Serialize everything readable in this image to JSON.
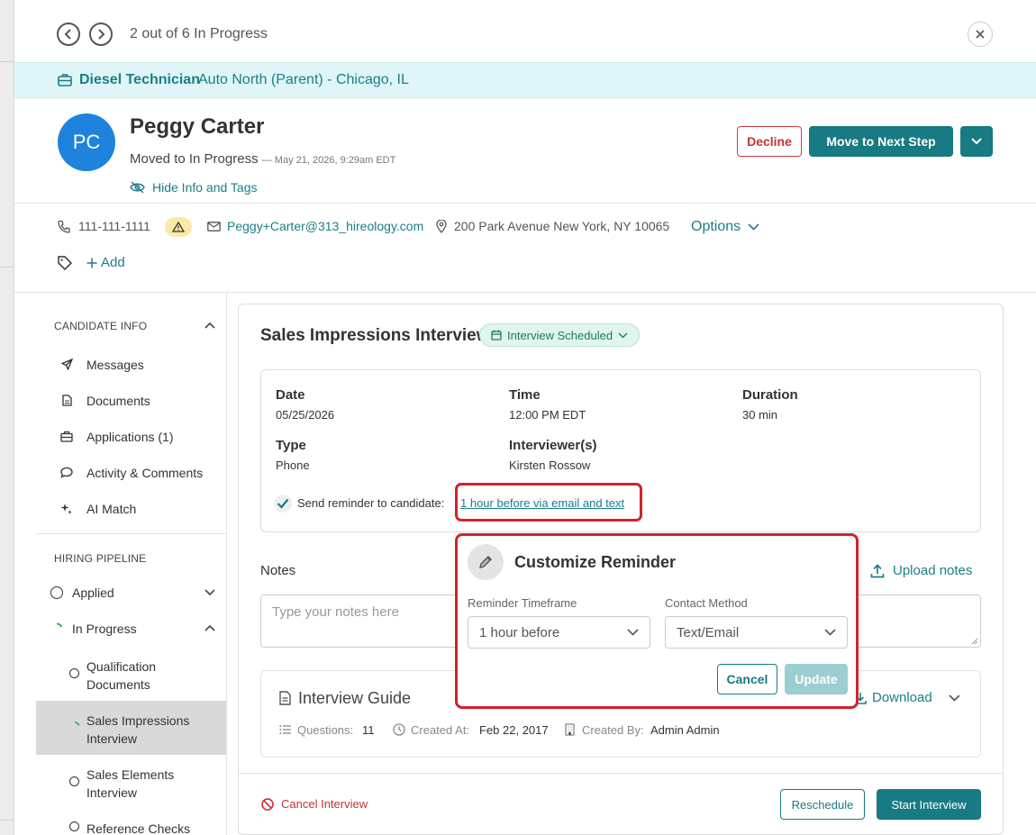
{
  "nav": {
    "counter": "2 out of 6 In Progress"
  },
  "job": {
    "title": "Diesel Technician",
    "location": "Auto North (Parent) - Chicago, IL"
  },
  "candidate": {
    "initials": "PC",
    "name": "Peggy Carter",
    "status": "Moved to In Progress",
    "status_time": "— May 21, 2026, 9:29am EDT",
    "hide_info": "Hide Info and Tags",
    "phone": "111-111-1111",
    "email": "Peggy+Carter@313_hireology.com",
    "address": "200 Park Avenue New York, NY 10065",
    "options": "Options",
    "add_tag": "Add"
  },
  "actions": {
    "decline": "Decline",
    "next_step": "Move to Next Step"
  },
  "sidebar": {
    "candidate_info_header": "CANDIDATE INFO",
    "candidate_items": [
      {
        "label": "Messages",
        "icon": "send-icon"
      },
      {
        "label": "Documents",
        "icon": "document-icon"
      },
      {
        "label": "Applications (1)",
        "icon": "briefcase-icon"
      },
      {
        "label": "Activity & Comments",
        "icon": "comment-icon"
      },
      {
        "label": "AI Match",
        "icon": "sparkle-icon"
      }
    ],
    "pipeline_header": "HIRING PIPELINE",
    "pipeline_items": [
      {
        "label": "Applied"
      },
      {
        "label": "In Progress"
      }
    ],
    "sub_items": [
      {
        "line1": "Qualification",
        "line2": "Documents"
      },
      {
        "line1": "Sales Impressions",
        "line2": "Interview"
      },
      {
        "line1": "Sales Elements",
        "line2": "Interview"
      },
      {
        "line1": "Reference Checks",
        "line2": ""
      }
    ]
  },
  "interview": {
    "title": "Sales Impressions Interview",
    "status_badge": "Interview Scheduled",
    "date_label": "Date",
    "date": "05/25/2026",
    "time_label": "Time",
    "time": "12:00 PM EDT",
    "duration_label": "Duration",
    "duration": "30 min",
    "type_label": "Type",
    "type": "Phone",
    "interviewer_label": "Interviewer(s)",
    "interviewer": "Kirsten Rossow",
    "reminder_label": "Send reminder to candidate:",
    "reminder_link": "1 hour before via email and text"
  },
  "notes": {
    "label": "Notes",
    "upload": "Upload notes",
    "placeholder": "Type your notes here"
  },
  "guide": {
    "title": "Interview Guide",
    "download": "Download",
    "questions_label": "Questions:",
    "questions": "11",
    "created_at_label": "Created At:",
    "created_at": "Feb 22, 2017",
    "created_by_label": "Created By:",
    "created_by": "Admin Admin"
  },
  "footer": {
    "cancel_interview": "Cancel Interview",
    "reschedule": "Reschedule",
    "start": "Start Interview"
  },
  "popover": {
    "title": "Customize Reminder",
    "timeframe_label": "Reminder Timeframe",
    "timeframe_value": "1 hour before",
    "method_label": "Contact Method",
    "method_value": "Text/Email",
    "cancel": "Cancel",
    "update": "Update"
  },
  "colors": {
    "accent": "#187a82",
    "danger": "#d1222c",
    "avatar": "#1d83dc",
    "job_bar": "#dff5f8"
  }
}
